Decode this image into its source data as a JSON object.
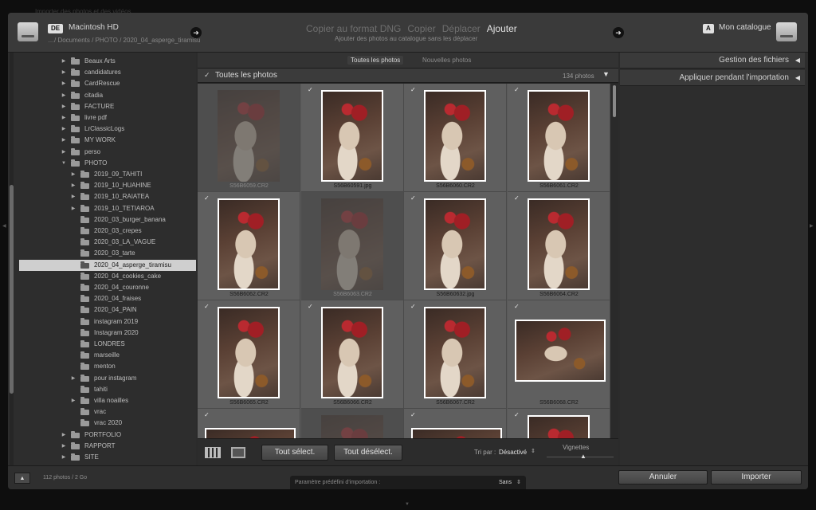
{
  "window_title": "Importer des photos et des vidéos",
  "header": {
    "source_badge": "DE",
    "source_name": "Macintosh HD",
    "source_path": "…/ Documents / PHOTO / 2020_04_asperge_tiramisu",
    "modes": [
      "Copier au format DNG",
      "Copier",
      "Déplacer",
      "Ajouter"
    ],
    "active_mode": "Ajouter",
    "mode_subtitle": "Ajouter des photos au catalogue sans les déplacer",
    "dest_badge": "A",
    "dest_name": "Mon catalogue"
  },
  "folders": [
    {
      "label": "Beaux Arts",
      "level": 1,
      "expand": true
    },
    {
      "label": "candidatures",
      "level": 1,
      "expand": true
    },
    {
      "label": "CardRescue",
      "level": 1,
      "expand": true
    },
    {
      "label": "citadia",
      "level": 1,
      "expand": true
    },
    {
      "label": "FACTURE",
      "level": 1,
      "expand": true
    },
    {
      "label": "livre pdf",
      "level": 1,
      "expand": true
    },
    {
      "label": "LrClassicLogs",
      "level": 1,
      "expand": true
    },
    {
      "label": "MY WORK",
      "level": 1,
      "expand": true
    },
    {
      "label": "perso",
      "level": 1,
      "expand": true
    },
    {
      "label": "PHOTO",
      "level": 1,
      "expand": "open"
    },
    {
      "label": "2019_09_TAHITI",
      "level": 2,
      "expand": true
    },
    {
      "label": "2019_10_HUAHINE",
      "level": 2,
      "expand": true
    },
    {
      "label": "2019_10_RAIATEA",
      "level": 2,
      "expand": true
    },
    {
      "label": "2019_10_TETIAROA",
      "level": 2,
      "expand": true
    },
    {
      "label": "2020_03_burger_banana",
      "level": 2,
      "expand": false
    },
    {
      "label": "2020_03_crepes",
      "level": 2,
      "expand": false
    },
    {
      "label": "2020_03_LA_VAGUE",
      "level": 2,
      "expand": false
    },
    {
      "label": "2020_03_tarte",
      "level": 2,
      "expand": false
    },
    {
      "label": "2020_04_asperge_tiramisu",
      "level": 2,
      "expand": false,
      "selected": true
    },
    {
      "label": "2020_04_cookies_cake",
      "level": 2,
      "expand": false
    },
    {
      "label": "2020_04_couronne",
      "level": 2,
      "expand": false
    },
    {
      "label": "2020_04_fraises",
      "level": 2,
      "expand": false
    },
    {
      "label": "2020_04_PAIN",
      "level": 2,
      "expand": false
    },
    {
      "label": "instagram 2019",
      "level": 2,
      "expand": false
    },
    {
      "label": "Instagram 2020",
      "level": 2,
      "expand": false
    },
    {
      "label": "LONDRES",
      "level": 2,
      "expand": false
    },
    {
      "label": "marseille",
      "level": 2,
      "expand": false
    },
    {
      "label": "menton",
      "level": 2,
      "expand": false
    },
    {
      "label": "pour instagram",
      "level": 2,
      "expand": true
    },
    {
      "label": "tahiti",
      "level": 2,
      "expand": false
    },
    {
      "label": "villa noailles",
      "level": 2,
      "expand": true
    },
    {
      "label": "vrac",
      "level": 2,
      "expand": false
    },
    {
      "label": "vrac 2020",
      "level": 2,
      "expand": false
    },
    {
      "label": "PORTFOLIO",
      "level": 1,
      "expand": true
    },
    {
      "label": "RAPPORT",
      "level": 1,
      "expand": true
    },
    {
      "label": "SITE",
      "level": 1,
      "expand": true
    }
  ],
  "tabs": [
    "Toutes les photos",
    "Nouvelles photos"
  ],
  "active_tab": "Toutes les photos",
  "grid_header": {
    "title": "Toutes les photos",
    "count": "134 photos"
  },
  "photos": [
    {
      "name": "S56B6059.CR2",
      "checked": false,
      "orient": "portrait"
    },
    {
      "name": "S56B60591.jpg",
      "checked": true,
      "orient": "portrait"
    },
    {
      "name": "S56B6060.CR2",
      "checked": true,
      "orient": "portrait"
    },
    {
      "name": "S56B6061.CR2",
      "checked": true,
      "orient": "portrait"
    },
    {
      "name": "S56B6062.CR2",
      "checked": true,
      "orient": "portrait"
    },
    {
      "name": "S56B6063.CR2",
      "checked": false,
      "orient": "portrait"
    },
    {
      "name": "S56B60632.jpg",
      "checked": true,
      "orient": "portrait"
    },
    {
      "name": "S56B6064.CR2",
      "checked": true,
      "orient": "portrait"
    },
    {
      "name": "S56B6065.CR2",
      "checked": true,
      "orient": "portrait"
    },
    {
      "name": "S56B6066.CR2",
      "checked": true,
      "orient": "portrait"
    },
    {
      "name": "S56B6067.CR2",
      "checked": true,
      "orient": "portrait"
    },
    {
      "name": "S56B6068.CR2",
      "checked": true,
      "orient": "landscape"
    },
    {
      "name": "",
      "checked": true,
      "orient": "landscape"
    },
    {
      "name": "",
      "checked": false,
      "orient": "portrait"
    },
    {
      "name": "",
      "checked": true,
      "orient": "landscape"
    },
    {
      "name": "",
      "checked": true,
      "orient": "portrait"
    }
  ],
  "toolbar": {
    "select_all": "Tout sélect.",
    "deselect_all": "Tout désélect.",
    "sort_label": "Tri par :",
    "sort_value": "Désactivé",
    "thumbnails_label": "Vignettes"
  },
  "right_panel": {
    "file_handling": "Gestion des fichiers",
    "apply_during_import": "Appliquer pendant l'importation"
  },
  "footer": {
    "photo_summary": "112 photos / 2 Go",
    "preset_label": "Paramètre prédéfini d'importation :",
    "preset_value": "Sans",
    "cancel": "Annuler",
    "import": "Importer"
  }
}
